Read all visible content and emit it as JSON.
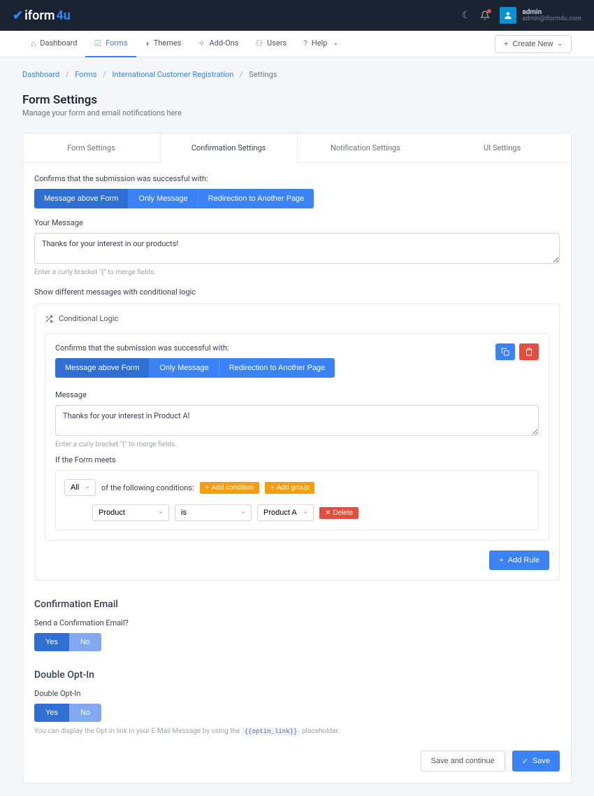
{
  "brand": {
    "pre": "iform",
    "post": "4u"
  },
  "user": {
    "name": "admin",
    "email": "admin@iform4u.com"
  },
  "nav": {
    "dashboard": "Dashboard",
    "forms": "Forms",
    "themes": "Themes",
    "addons": "Add-Ons",
    "users": "Users",
    "help": "Help",
    "create": "Create New"
  },
  "breadcrumb": {
    "dashboard": "Dashboard",
    "forms": "Forms",
    "form_name": "International Customer Registration",
    "current": "Settings"
  },
  "page": {
    "title": "Form Settings",
    "sub": "Manage your form and email notifications here"
  },
  "tabs": {
    "form": "Form Settings",
    "confirm": "Confirmation Settings",
    "notif": "Notification Settings",
    "ui": "UI Settings"
  },
  "confirm": {
    "label1": "Confirms that the submission was successful with:",
    "opt1": "Message above Form",
    "opt2": "Only Message",
    "opt3": "Redirection to Another Page",
    "your_msg_label": "Your Message",
    "your_msg_value": "Thanks for your interest in our products!",
    "merge_hint": "Enter a curly bracket \"{\" to merge fields.",
    "cond_label": "Show different messages with conditional logic",
    "cond_title": "Conditional Logic",
    "rule": {
      "header": "Confirms that the submission was successful with:",
      "r_opt1": "Message above Form",
      "r_opt2": "Only Message",
      "r_opt3": "Redirection to Another Page",
      "msg_label": "Message",
      "msg_value": "Thanks for your interest in Product A!",
      "merge_hint": "Enter a curly bracket \"{\" to merge fields.",
      "meets_label": "If the Form meets",
      "scope": "All",
      "scope_after": "of the following conditions:",
      "add_cond": "Add condition",
      "add_group": "Add group",
      "field": "Product",
      "op": "is",
      "value": "Product A",
      "delete": "Delete"
    },
    "add_rule": "Add Rule"
  },
  "email": {
    "title": "Confirmation Email",
    "send_label": "Send a Confirmation Email?",
    "yes": "Yes",
    "no": "No"
  },
  "optin": {
    "title": "Double Opt-In",
    "label": "Double Opt-In",
    "yes": "Yes",
    "no": "No",
    "help_pre": "You can display the Opt-in link in your E-Mail Message by using the ",
    "help_code": "{{optin_link}}",
    "help_post": " placeholder."
  },
  "footer": {
    "save_continue": "Save and continue",
    "save": "Save"
  }
}
